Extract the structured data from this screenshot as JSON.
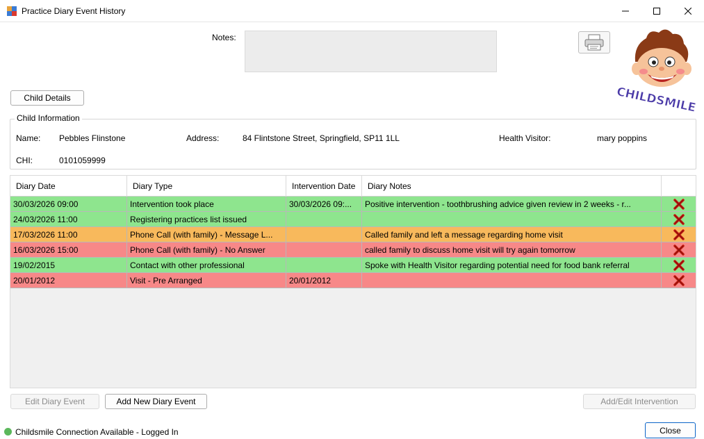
{
  "window": {
    "title": "Practice Diary Event History"
  },
  "notes": {
    "label": "Notes:",
    "value": ""
  },
  "logo": {
    "text": "CHILDSMILE"
  },
  "buttons": {
    "child_details": "Child Details",
    "edit_diary_event": "Edit Diary Event",
    "add_new_diary_event": "Add New Diary Event",
    "add_edit_intervention": "Add/Edit Intervention",
    "close": "Close"
  },
  "child_info": {
    "title": "Child Information",
    "name_label": "Name:",
    "name": "Pebbles Flinstone",
    "address_label": "Address:",
    "address": "84 Flintstone Street, Springfield, SP11 1LL",
    "health_visitor_label": "Health Visitor:",
    "health_visitor": "mary poppins",
    "chi_label": "CHI:",
    "chi": "0101059999"
  },
  "table": {
    "headers": [
      "Diary Date",
      "Diary Type",
      "Intervention Date",
      "Diary Notes"
    ],
    "rows": [
      {
        "date": "30/03/2026 09:00",
        "type": "Intervention took place",
        "intervention_date": "30/03/2026 09:...",
        "notes": "Positive intervention - toothbrushing advice given review in 2 weeks - r...",
        "color": "#8ee58e"
      },
      {
        "date": "24/03/2026 11:00",
        "type": "Registering practices list issued",
        "intervention_date": "",
        "notes": "",
        "color": "#8ee58e"
      },
      {
        "date": "17/03/2026 11:00",
        "type": "Phone Call (with family) - Message L...",
        "intervention_date": "",
        "notes": "Called family and left a message regarding home visit",
        "color": "#f8b95c"
      },
      {
        "date": "16/03/2026 15:00",
        "type": "Phone Call (with family) - No Answer",
        "intervention_date": "",
        "notes": "called family to discuss home visit will try again tomorrow",
        "color": "#f78888"
      },
      {
        "date": "19/02/2015",
        "type": "Contact with other professional",
        "intervention_date": "",
        "notes": "Spoke with Health Visitor regarding potential need for food bank referral",
        "color": "#8ee58e"
      },
      {
        "date": "20/01/2012",
        "type": "Visit - Pre Arranged",
        "intervention_date": "20/01/2012",
        "notes": "",
        "color": "#f78888"
      }
    ]
  },
  "status": {
    "text": "Childsmile Connection Available - Logged In",
    "color": "#5cb85c"
  }
}
